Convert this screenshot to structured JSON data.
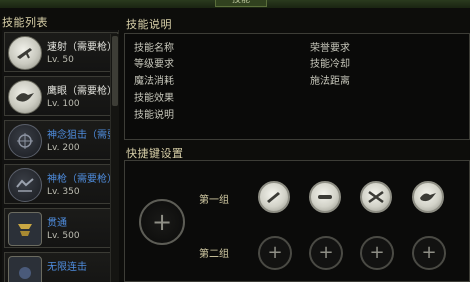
{
  "window": {
    "title": "技能"
  },
  "list": {
    "header": "技能列表",
    "items": [
      {
        "name": "速射（需要枪）",
        "level": "Lv. 50",
        "icon": "rapid-fire-icon",
        "color": "white"
      },
      {
        "name": "鹰眼（需要枪）",
        "level": "Lv. 100",
        "icon": "hawk-eye-icon",
        "color": "white"
      },
      {
        "name": "神念狙击（需要",
        "level": "Lv. 200",
        "icon": "sniper-icon",
        "color": "blue"
      },
      {
        "name": "神枪（需要枪）",
        "level": "Lv. 350",
        "icon": "divine-gun-icon",
        "color": "blue"
      },
      {
        "name": "贯通",
        "level": "Lv. 500",
        "icon": "pierce-icon",
        "color": "blue"
      },
      {
        "name": "无限连击",
        "level": "",
        "icon": "combo-icon",
        "color": "blue"
      }
    ]
  },
  "desc": {
    "header": "技能说明",
    "left_labels": [
      "技能名称",
      "等级要求",
      "魔法消耗",
      "技能效果",
      "技能说明"
    ],
    "right_labels": [
      "荣誉要求",
      "技能冷却",
      "施法距离"
    ]
  },
  "hotkey": {
    "header": "快捷键设置",
    "group1": "第一组",
    "group2": "第二组"
  }
}
